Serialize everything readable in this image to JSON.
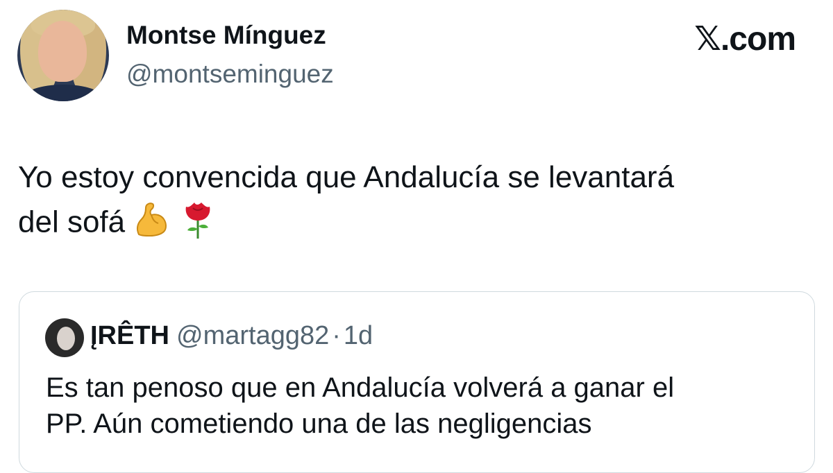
{
  "author": {
    "display_name": "Montse Mínguez",
    "handle": "@montseminguez"
  },
  "brand": "𝕏.com",
  "tweet": {
    "line1": "Yo estoy convencida que Andalucía se levantará",
    "line2": "del sofá",
    "emojis": [
      "flexed-biceps",
      "rose"
    ]
  },
  "quote": {
    "display_name": "ĮRÊTH",
    "handle": "@martagg82",
    "separator": "·",
    "time": "1d",
    "line1": "Es tan penoso que en Andalucía volverá a ganar el",
    "line2": "PP. Aún cometiendo una de las negligencias"
  }
}
